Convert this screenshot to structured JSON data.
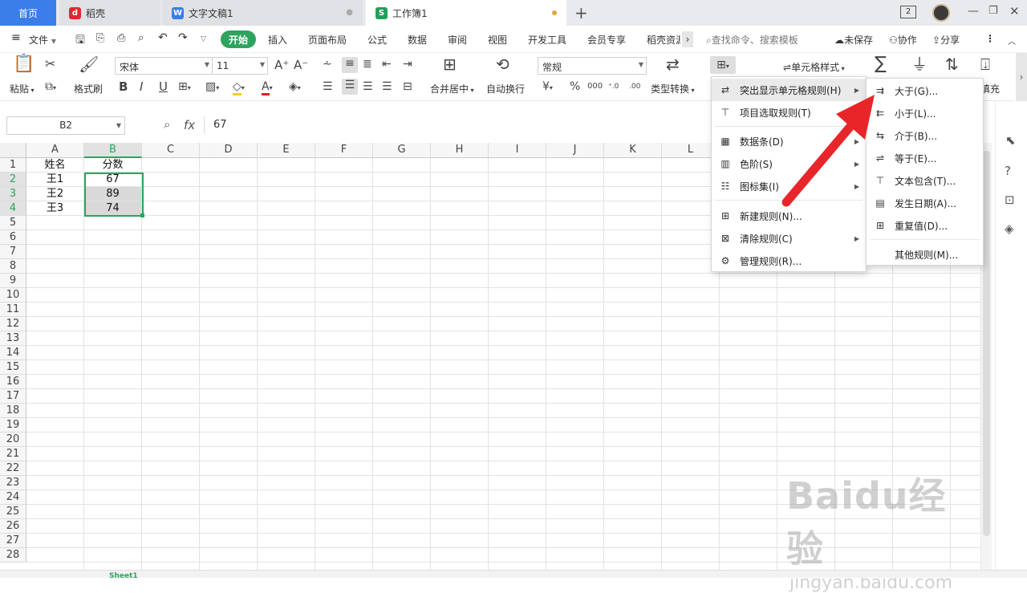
{
  "tabs": {
    "home": "首页",
    "daoke": "稻壳",
    "doc": "文字文稿1",
    "workbook": "工作簿1",
    "page_count": "2"
  },
  "menubar": {
    "file": "文件",
    "items": [
      "开始",
      "插入",
      "页面布局",
      "公式",
      "数据",
      "审阅",
      "视图",
      "开发工具",
      "会员专享",
      "稻壳资源"
    ],
    "search_placeholder": "查找命令、搜索模板",
    "unsaved": "未保存",
    "collab": "协作",
    "share": "分享"
  },
  "ribbon": {
    "paste": "粘贴",
    "format_painter": "格式刷",
    "font_name": "宋体",
    "font_size": "11",
    "merge_center": "合并居中",
    "wrap_text": "自动换行",
    "number_format": "常规",
    "type_convert": "类型转换",
    "cell_style": "单元格样式",
    "fill_partial": "填充"
  },
  "formula_bar": {
    "name_box": "B2",
    "fx": "fx",
    "value": "67"
  },
  "sheet": {
    "columns": [
      "A",
      "B",
      "C",
      "D",
      "E",
      "F",
      "G",
      "H",
      "I",
      "J",
      "K",
      "L"
    ],
    "rows": [
      "1",
      "2",
      "3",
      "4",
      "5",
      "6",
      "7",
      "8",
      "9",
      "10",
      "11",
      "12",
      "13",
      "14",
      "15",
      "16",
      "17",
      "18",
      "19",
      "20",
      "21",
      "22",
      "23",
      "24",
      "25",
      "26",
      "27",
      "28"
    ],
    "cells": {
      "A1": "姓名",
      "B1": "分数",
      "A2": "王1",
      "B2": "67",
      "A3": "王2",
      "B3": "89",
      "A4": "王3",
      "B4": "74"
    },
    "sheet_tab": "Sheet1"
  },
  "cond_menu": {
    "items": [
      {
        "label": "突出显示单元格规则(H)",
        "icon": "highlight-rule-icon",
        "sub": true
      },
      {
        "label": "项目选取规则(T)",
        "icon": "top-rule-icon",
        "sub": true
      },
      {
        "label": "数据条(D)",
        "icon": "data-bar-icon",
        "sub": true
      },
      {
        "label": "色阶(S)",
        "icon": "color-scale-icon",
        "sub": true
      },
      {
        "label": "图标集(I)",
        "icon": "icon-set-icon",
        "sub": true
      },
      {
        "label": "新建规则(N)...",
        "icon": "new-rule-icon",
        "sub": false
      },
      {
        "label": "清除规则(C)",
        "icon": "clear-rule-icon",
        "sub": true
      },
      {
        "label": "管理规则(R)...",
        "icon": "manage-rule-icon",
        "sub": false
      }
    ]
  },
  "highlight_submenu": {
    "items": [
      {
        "label": "大于(G)...",
        "icon": "greater-than-icon"
      },
      {
        "label": "小于(L)...",
        "icon": "less-than-icon"
      },
      {
        "label": "介于(B)...",
        "icon": "between-icon"
      },
      {
        "label": "等于(E)...",
        "icon": "equal-icon"
      },
      {
        "label": "文本包含(T)...",
        "icon": "text-contains-icon"
      },
      {
        "label": "发生日期(A)...",
        "icon": "date-occurring-icon"
      },
      {
        "label": "重复值(D)...",
        "icon": "duplicate-values-icon"
      },
      {
        "label": "其他规则(M)...",
        "icon": ""
      }
    ]
  },
  "watermark": {
    "brand": "Baidu经验",
    "url": "jingyan.baidu.com"
  },
  "colors": {
    "accent_green": "#2ea35d",
    "tab_blue": "#3b7de9",
    "arrow_red": "#e8262a"
  }
}
